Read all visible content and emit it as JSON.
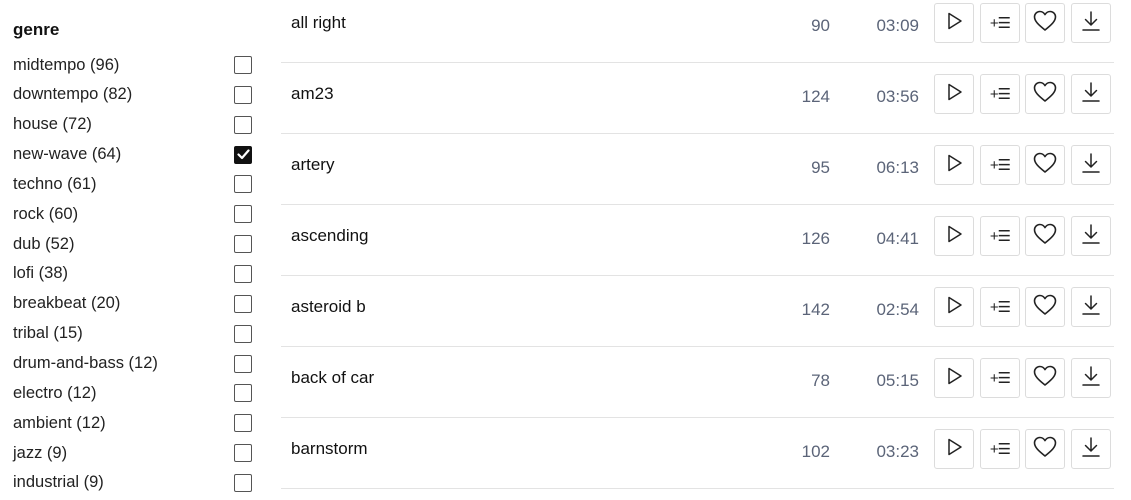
{
  "sidebar": {
    "heading": "genre",
    "genres": [
      {
        "label": "midtempo (96)",
        "checked": false
      },
      {
        "label": "downtempo (82)",
        "checked": false
      },
      {
        "label": "house (72)",
        "checked": false
      },
      {
        "label": "new-wave (64)",
        "checked": true
      },
      {
        "label": "techno (61)",
        "checked": false
      },
      {
        "label": "rock (60)",
        "checked": false
      },
      {
        "label": "dub (52)",
        "checked": false
      },
      {
        "label": "lofi (38)",
        "checked": false
      },
      {
        "label": "breakbeat (20)",
        "checked": false
      },
      {
        "label": "tribal (15)",
        "checked": false
      },
      {
        "label": "drum-and-bass (12)",
        "checked": false
      },
      {
        "label": "electro (12)",
        "checked": false
      },
      {
        "label": "ambient (12)",
        "checked": false
      },
      {
        "label": "jazz (9)",
        "checked": false
      },
      {
        "label": "industrial (9)",
        "checked": false
      }
    ]
  },
  "tracks": [
    {
      "title": "all right",
      "bpm": "90",
      "duration": "03:09"
    },
    {
      "title": "am23",
      "bpm": "124",
      "duration": "03:56"
    },
    {
      "title": "artery",
      "bpm": "95",
      "duration": "06:13"
    },
    {
      "title": "ascending",
      "bpm": "126",
      "duration": "04:41"
    },
    {
      "title": "asteroid b",
      "bpm": "142",
      "duration": "02:54"
    },
    {
      "title": "back of car",
      "bpm": "78",
      "duration": "05:15"
    },
    {
      "title": "barnstorm",
      "bpm": "102",
      "duration": "03:23"
    }
  ],
  "icons": {
    "play": "play-icon",
    "queue": "add-to-queue-icon",
    "favorite": "heart-icon",
    "download": "download-icon",
    "queue_glyph": "+☰"
  }
}
